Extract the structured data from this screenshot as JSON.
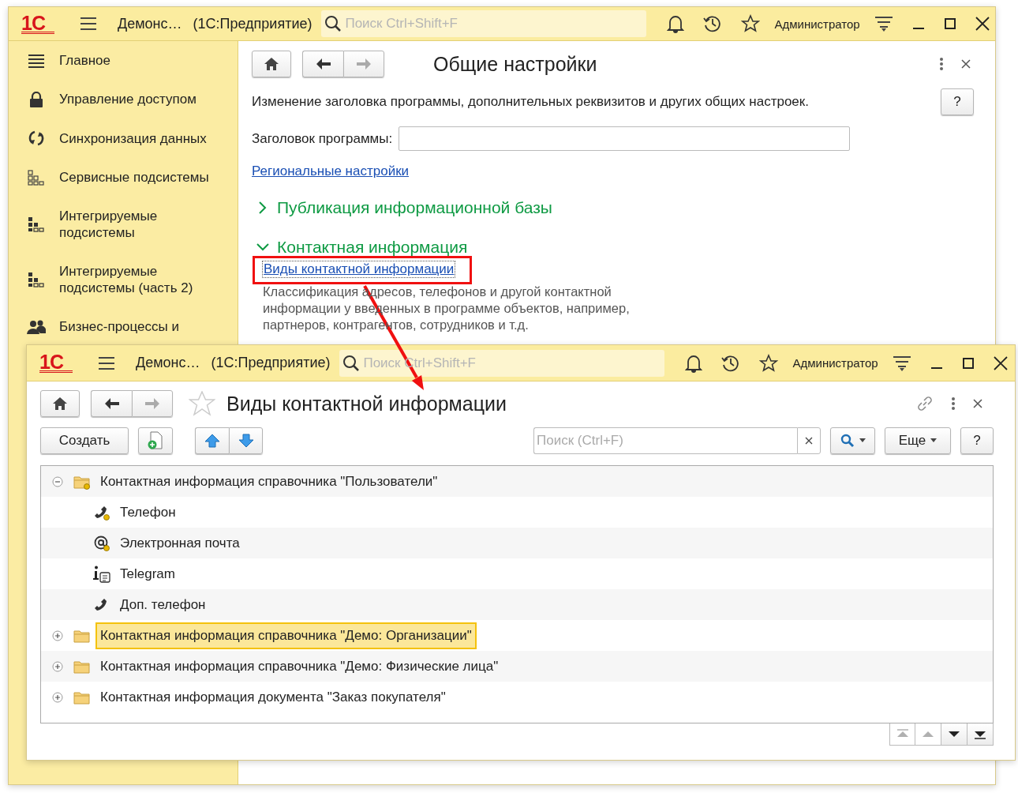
{
  "main_window": {
    "titlebar": {
      "logo": "1С",
      "app_title": "Демонс…",
      "platform": "(1С:Предприятие)",
      "search_placeholder": "Поиск Ctrl+Shift+F",
      "user": "Администратор"
    },
    "sidebar": {
      "items": [
        {
          "label": "Главное"
        },
        {
          "label": "Управление доступом"
        },
        {
          "label": "Синхронизация данных"
        },
        {
          "label": "Сервисные подсистемы"
        },
        {
          "label": "Интегрируемые подсистемы"
        },
        {
          "label": "Интегрируемые подсистемы (часть 2)"
        },
        {
          "label": "Бизнес-процессы и"
        }
      ]
    },
    "form": {
      "title": "Общие настройки",
      "help": "?",
      "description": "Изменение заголовка программы, дополнительных реквизитов и других общих настроек.",
      "field": {
        "label": "Заголовок программы:"
      },
      "link": "Региональные настройки",
      "sections": [
        {
          "title": "Публикация информационной базы",
          "expanded": false
        },
        {
          "title": "Контактная информация",
          "expanded": true,
          "link": "Виды контактной информации",
          "note": "Классификация адресов, телефонов и другой контактной информации у введенных в программе объектов, например, партнеров, контрагентов, сотрудников и т.д."
        }
      ]
    }
  },
  "front_window": {
    "titlebar": {
      "logo": "1С",
      "app_title": "Демонс…",
      "platform": "(1С:Предприятие)",
      "search_placeholder": "Поиск Ctrl+Shift+F",
      "user": "Администратор"
    },
    "form": {
      "title": "Виды контактной информации",
      "favorite": false,
      "toolbar": {
        "create": "Создать",
        "search_placeholder": "Поиск (Ctrl+F)",
        "more": "Еще",
        "help": "?"
      },
      "tree": [
        {
          "label": "Контактная информация справочника \"Пользователи\"",
          "expanded": true,
          "predefined": true,
          "selected": false,
          "children": [
            {
              "kind": "phone",
              "label": "Телефон",
              "predefined": true,
              "selected": false
            },
            {
              "kind": "email",
              "label": "Электронная почта",
              "predefined": true,
              "selected": false
            },
            {
              "kind": "messenger",
              "label": "Telegram",
              "predefined": false,
              "selected": false
            },
            {
              "kind": "phone",
              "label": "Доп. телефон",
              "predefined": false,
              "selected": false
            }
          ]
        },
        {
          "label": "Контактная информация справочника \"Демо: Организации\"",
          "expanded": false,
          "predefined": false,
          "selected": true
        },
        {
          "label": "Контактная информация справочника \"Демо: Физические лица\"",
          "expanded": false,
          "predefined": false,
          "selected": false
        },
        {
          "label": "Контактная информация документа \"Заказ покупателя\"",
          "expanded": false,
          "predefined": false,
          "selected": false
        }
      ],
      "nav_buttons": [
        {
          "disabled": true
        },
        {
          "disabled": true
        },
        {
          "disabled": false
        },
        {
          "disabled": false
        }
      ]
    }
  }
}
